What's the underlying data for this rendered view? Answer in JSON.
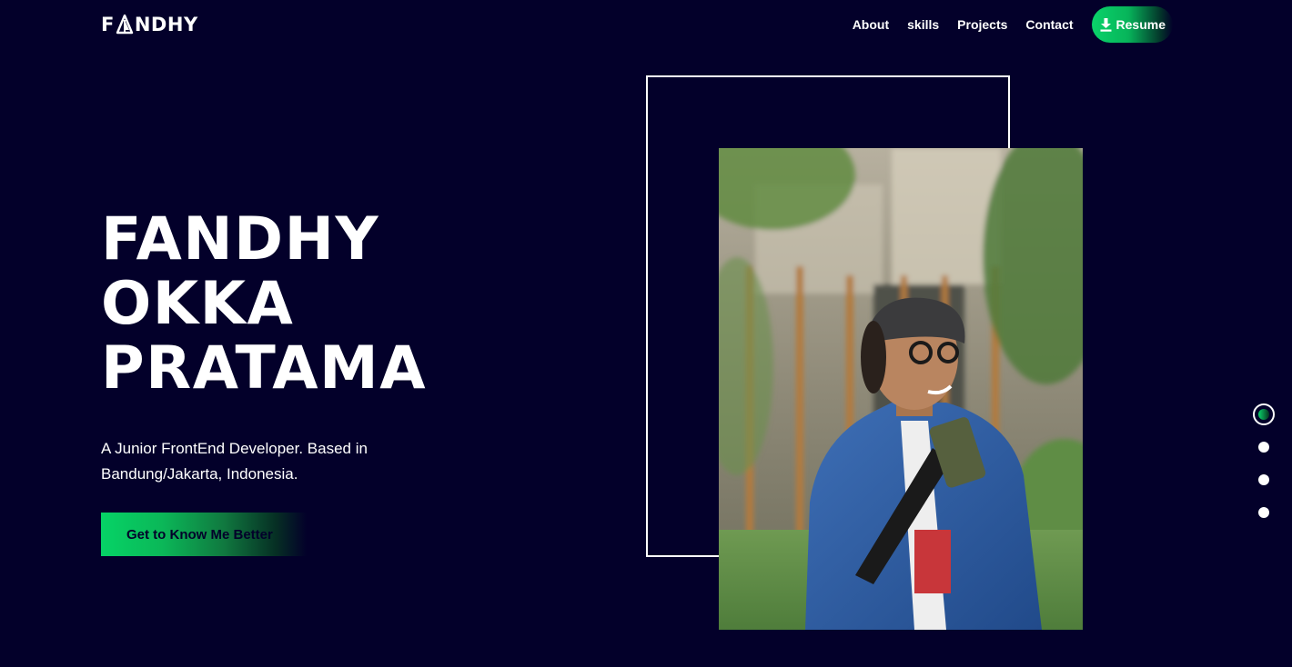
{
  "header": {
    "logo_text": "FANDHY",
    "nav": [
      {
        "label": "About"
      },
      {
        "label": "skills"
      },
      {
        "label": "Projects"
      },
      {
        "label": "Contact"
      }
    ],
    "resume_label": "Resume",
    "resume_icon": "download-icon"
  },
  "hero": {
    "name_lines": [
      "FANDHY",
      "OKKA",
      "PRATAMA"
    ],
    "tagline": "A Junior FrontEnd Developer. Based in Bandung/Jakarta, Indonesia.",
    "cta_label": "Get to Know Me Better"
  },
  "portrait": {
    "subject": "profile-photo"
  },
  "section_dots": {
    "count": 4,
    "active_index": 0
  },
  "colors": {
    "background": "#03002a",
    "accent": "#0ad36a",
    "text": "#ffffff"
  }
}
